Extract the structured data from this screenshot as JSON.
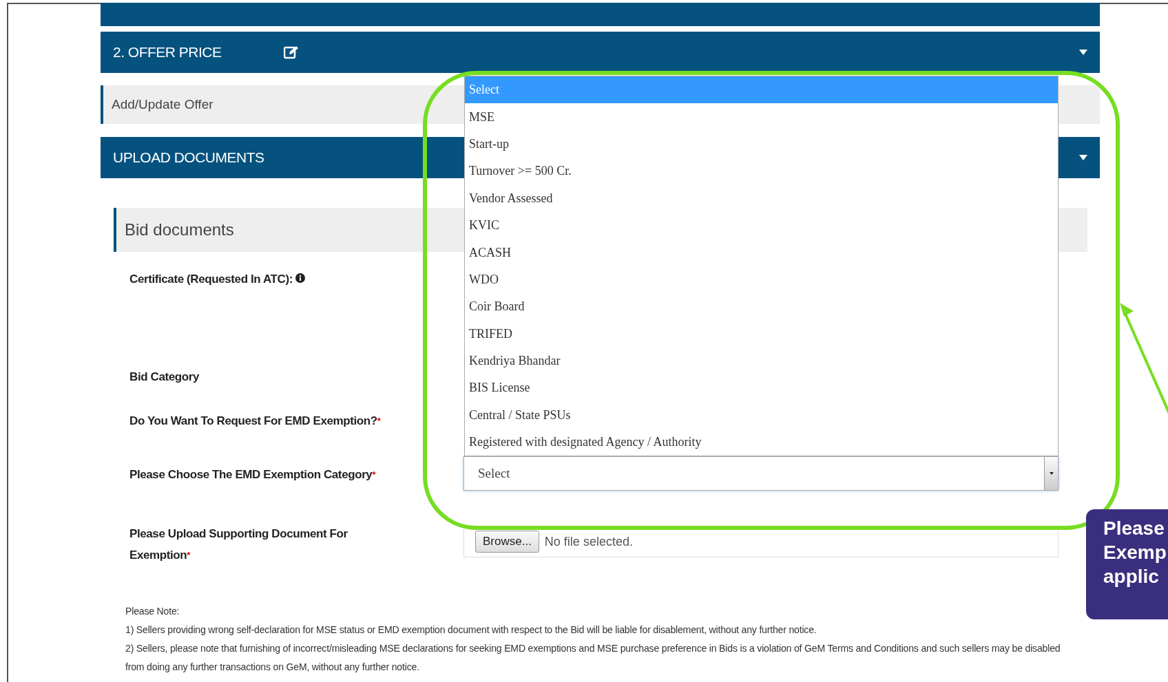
{
  "offer_section": {
    "title": "2. OFFER PRICE"
  },
  "offer_link": "Add/Update Offer",
  "upload_section": {
    "title": "UPLOAD DOCUMENTS"
  },
  "panel_title": "Bid documents",
  "form": [
    {
      "kind": "text",
      "label": "Certificate (Requested In ATC):",
      "info": true
    },
    {
      "kind": "text",
      "label": "Bid Category"
    },
    {
      "kind": "text",
      "label": "Do You Want To Request For EMD Exemption?",
      "mark": "*"
    },
    {
      "kind": "select",
      "label": "Please Choose The EMD Exemption Category",
      "mark": "*",
      "value": "Select"
    },
    {
      "kind": "file",
      "label": "Please Upload Supporting Document For Exemption",
      "mark": "*",
      "button": "Browse...",
      "value": "No file selected."
    }
  ],
  "dropdown": {
    "options": [
      {
        "label": "Select",
        "selected": true
      },
      {
        "label": "MSE",
        "selected": false
      },
      {
        "label": "Start-up",
        "selected": false
      },
      {
        "label": "Turnover >= 500 Cr.",
        "selected": false
      },
      {
        "label": "Vendor Assessed",
        "selected": false
      },
      {
        "label": "KVIC",
        "selected": false
      },
      {
        "label": "ACASH",
        "selected": false
      },
      {
        "label": "WDO",
        "selected": false
      },
      {
        "label": "Coir Board",
        "selected": false
      },
      {
        "label": "TRIFED",
        "selected": false
      },
      {
        "label": "Kendriya Bhandar",
        "selected": false
      },
      {
        "label": "BIS License",
        "selected": false
      },
      {
        "label": "Central / State PSUs",
        "selected": false
      },
      {
        "label": "Registered with designated Agency / Authority",
        "selected": false
      }
    ]
  },
  "notes": {
    "heading": "Please Note:",
    "items": [
      "1) Sellers providing wrong self-declaration for MSE status or EMD exemption document with respect to the Bid will be liable for disablement, without any further notice.",
      "2) Sellers, please note that furnishing of incorrect/misleading MSE declarations for seeking EMD exemptions and MSE purchase preference in Bids is a violation of GeM Terms and Conditions and such sellers may be disabled from doing any further transactions on GeM, without any further notice."
    ]
  },
  "callout": {
    "lines": [
      "Please",
      "Exemp",
      "applic"
    ]
  }
}
